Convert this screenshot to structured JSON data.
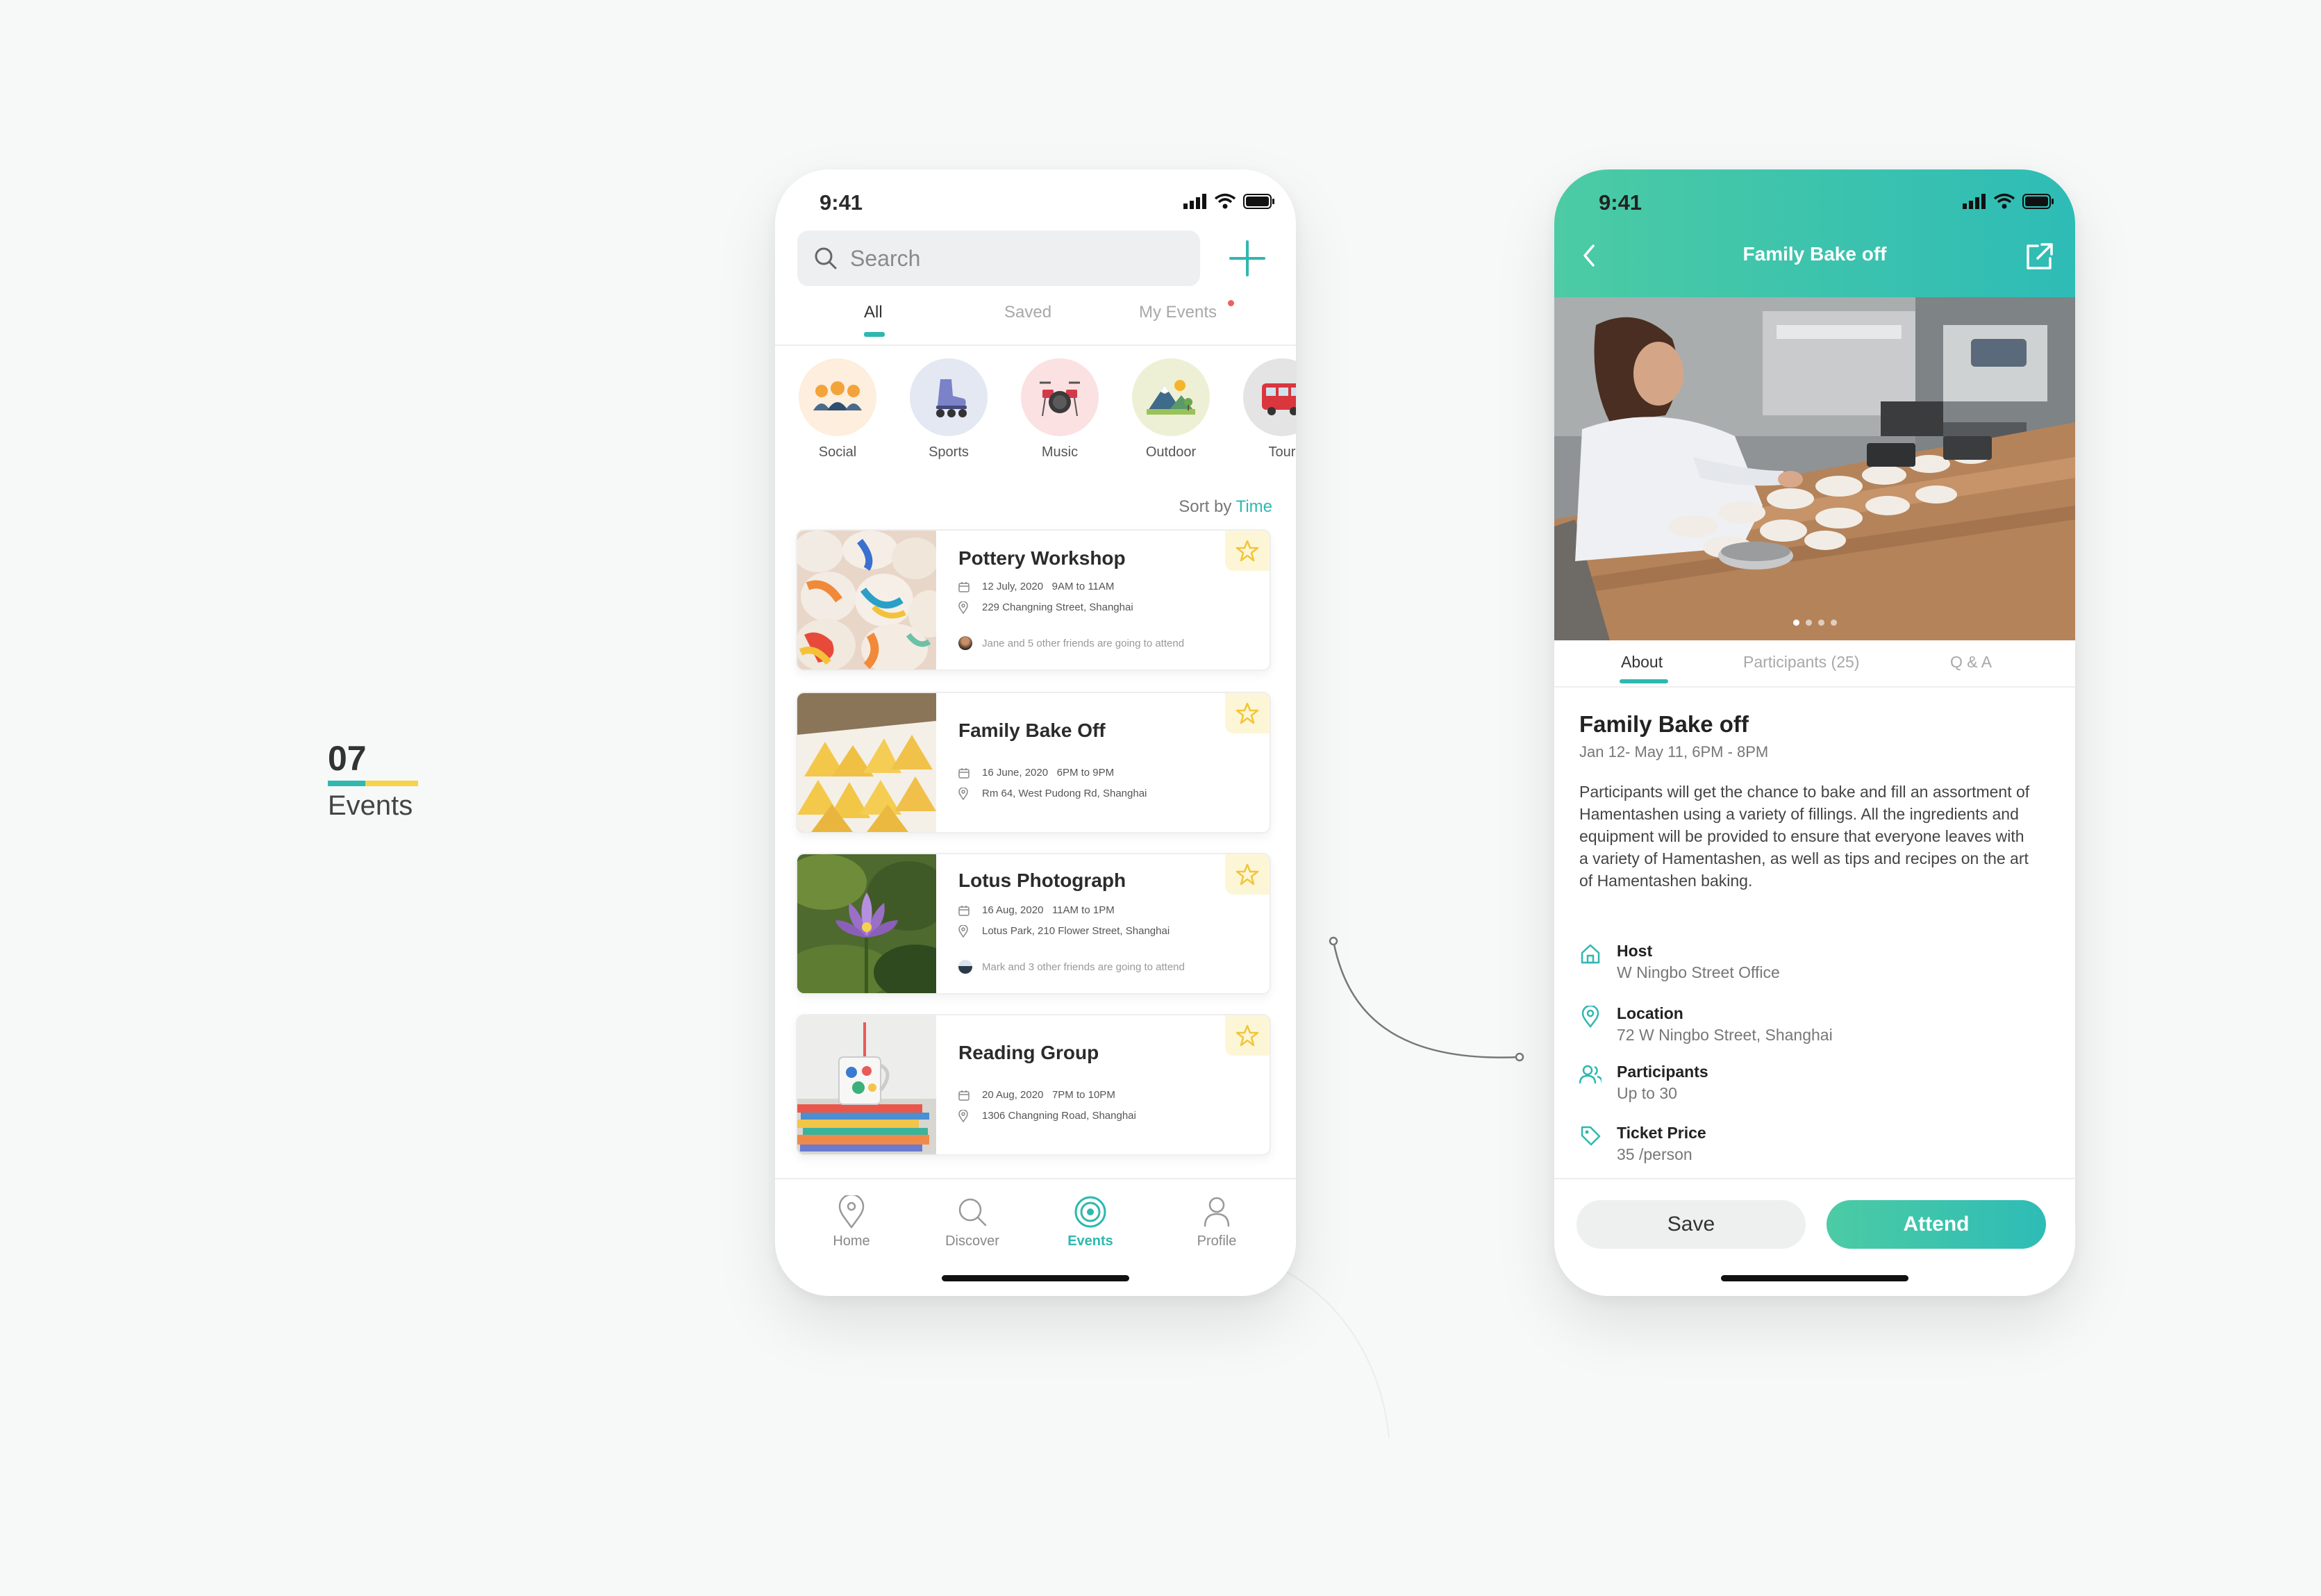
{
  "section": {
    "number": "07",
    "name": "Events"
  },
  "colors": {
    "accent": "#2eb8b0",
    "accent_gradient_start": "#4ccba4",
    "yellow": "#f5d34a",
    "notification": "#f06060"
  },
  "left_phone": {
    "status_time": "9:41",
    "search": {
      "placeholder": "Search"
    },
    "tabs": [
      {
        "label": "All",
        "active": true
      },
      {
        "label": "Saved",
        "active": false
      },
      {
        "label": "My Events",
        "active": false,
        "has_notification": true
      }
    ],
    "categories": [
      {
        "label": "Social",
        "icon": "people-group-icon"
      },
      {
        "label": "Sports",
        "icon": "roller-skate-icon"
      },
      {
        "label": "Music",
        "icon": "drum-kit-icon"
      },
      {
        "label": "Outdoor",
        "icon": "mountain-landscape-icon"
      },
      {
        "label": "Tour",
        "icon": "bus-icon"
      }
    ],
    "sort": {
      "prefix": "Sort by",
      "value": "Time"
    },
    "events": [
      {
        "title": "Pottery Workshop",
        "date": "12 July, 2020",
        "time": "9AM to 11AM",
        "address": "229 Changning Street, Shanghai",
        "friends": "Jane and 5 other friends are going to attend"
      },
      {
        "title": "Family Bake Off",
        "date": "16 June, 2020",
        "time": "6PM to 9PM",
        "address": "Rm 64, West Pudong Rd, Shanghai"
      },
      {
        "title": "Lotus Photograph",
        "date": "16 Aug, 2020",
        "time": "11AM to 1PM",
        "address": "Lotus Park, 210 Flower Street, Shanghai",
        "friends": "Mark and 3 other friends are going to attend"
      },
      {
        "title": "Reading Group",
        "date": "20 Aug, 2020",
        "time": "7PM to 10PM",
        "address": "1306 Changning Road, Shanghai"
      }
    ],
    "nav": [
      {
        "label": "Home",
        "icon": "map-pin-icon",
        "active": false
      },
      {
        "label": "Discover",
        "icon": "search-icon",
        "active": false
      },
      {
        "label": "Events",
        "icon": "target-icon",
        "active": true
      },
      {
        "label": "Profile",
        "icon": "person-icon",
        "active": false
      }
    ]
  },
  "right_phone": {
    "status_time": "9:41",
    "title": "Family Bake off",
    "carousel": {
      "count": 4,
      "active": 1
    },
    "tabs": [
      {
        "label": "About",
        "active": true
      },
      {
        "label": "Participants (25)",
        "active": false
      },
      {
        "label": "Q & A",
        "active": false
      }
    ],
    "event": {
      "title": "Family Bake off",
      "date": "Jan 12- May 11, 6PM - 8PM",
      "description": "Participants will get the chance to bake and fill an assortment of Hamentashen using a variety of fillings. All the ingredients and equipment will be provided to ensure that everyone leaves with a variety of Hamentashen, as well as tips and recipes on the art of Hamentashen baking."
    },
    "info": [
      {
        "label": "Host",
        "value": "W Ningbo Street Office",
        "icon": "home-icon"
      },
      {
        "label": "Location",
        "value": "72 W Ningbo Street, Shanghai",
        "icon": "location-pin-icon"
      },
      {
        "label": "Participants",
        "value": "Up to 30",
        "icon": "people-icon"
      },
      {
        "label": "Ticket Price",
        "value": "35 /person",
        "icon": "price-tag-icon"
      }
    ],
    "actions": {
      "save": "Save",
      "attend": "Attend"
    }
  }
}
